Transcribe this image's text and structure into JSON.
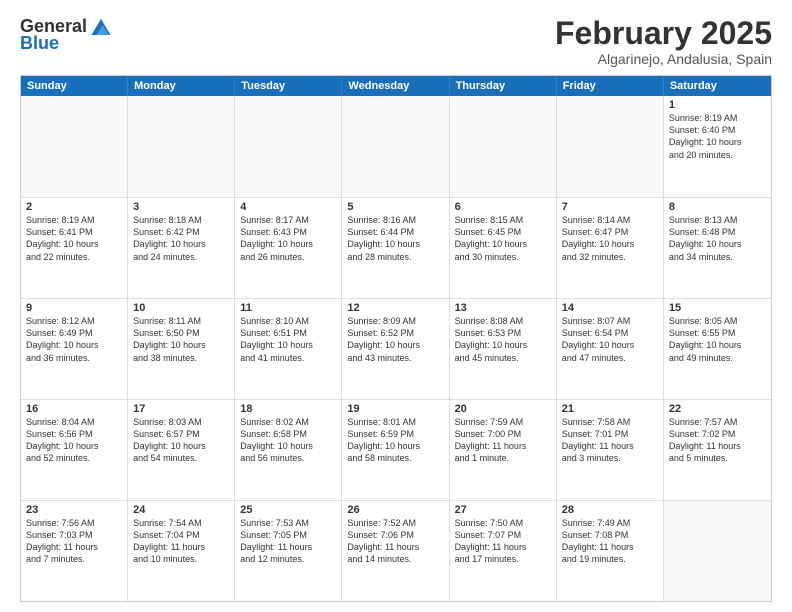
{
  "header": {
    "logo": {
      "general": "General",
      "blue": "Blue"
    },
    "title": "February 2025",
    "subtitle": "Algarinejo, Andalusia, Spain"
  },
  "days_of_week": [
    "Sunday",
    "Monday",
    "Tuesday",
    "Wednesday",
    "Thursday",
    "Friday",
    "Saturday"
  ],
  "weeks": [
    [
      {
        "day": "",
        "empty": true
      },
      {
        "day": "",
        "empty": true
      },
      {
        "day": "",
        "empty": true
      },
      {
        "day": "",
        "empty": true
      },
      {
        "day": "",
        "empty": true
      },
      {
        "day": "",
        "empty": true
      },
      {
        "day": "1",
        "lines": [
          "Sunrise: 8:19 AM",
          "Sunset: 6:40 PM",
          "Daylight: 10 hours",
          "and 20 minutes."
        ]
      }
    ],
    [
      {
        "day": "2",
        "lines": [
          "Sunrise: 8:19 AM",
          "Sunset: 6:41 PM",
          "Daylight: 10 hours",
          "and 22 minutes."
        ]
      },
      {
        "day": "3",
        "lines": [
          "Sunrise: 8:18 AM",
          "Sunset: 6:42 PM",
          "Daylight: 10 hours",
          "and 24 minutes."
        ]
      },
      {
        "day": "4",
        "lines": [
          "Sunrise: 8:17 AM",
          "Sunset: 6:43 PM",
          "Daylight: 10 hours",
          "and 26 minutes."
        ]
      },
      {
        "day": "5",
        "lines": [
          "Sunrise: 8:16 AM",
          "Sunset: 6:44 PM",
          "Daylight: 10 hours",
          "and 28 minutes."
        ]
      },
      {
        "day": "6",
        "lines": [
          "Sunrise: 8:15 AM",
          "Sunset: 6:45 PM",
          "Daylight: 10 hours",
          "and 30 minutes."
        ]
      },
      {
        "day": "7",
        "lines": [
          "Sunrise: 8:14 AM",
          "Sunset: 6:47 PM",
          "Daylight: 10 hours",
          "and 32 minutes."
        ]
      },
      {
        "day": "8",
        "lines": [
          "Sunrise: 8:13 AM",
          "Sunset: 6:48 PM",
          "Daylight: 10 hours",
          "and 34 minutes."
        ]
      }
    ],
    [
      {
        "day": "9",
        "lines": [
          "Sunrise: 8:12 AM",
          "Sunset: 6:49 PM",
          "Daylight: 10 hours",
          "and 36 minutes."
        ]
      },
      {
        "day": "10",
        "lines": [
          "Sunrise: 8:11 AM",
          "Sunset: 6:50 PM",
          "Daylight: 10 hours",
          "and 38 minutes."
        ]
      },
      {
        "day": "11",
        "lines": [
          "Sunrise: 8:10 AM",
          "Sunset: 6:51 PM",
          "Daylight: 10 hours",
          "and 41 minutes."
        ]
      },
      {
        "day": "12",
        "lines": [
          "Sunrise: 8:09 AM",
          "Sunset: 6:52 PM",
          "Daylight: 10 hours",
          "and 43 minutes."
        ]
      },
      {
        "day": "13",
        "lines": [
          "Sunrise: 8:08 AM",
          "Sunset: 6:53 PM",
          "Daylight: 10 hours",
          "and 45 minutes."
        ]
      },
      {
        "day": "14",
        "lines": [
          "Sunrise: 8:07 AM",
          "Sunset: 6:54 PM",
          "Daylight: 10 hours",
          "and 47 minutes."
        ]
      },
      {
        "day": "15",
        "lines": [
          "Sunrise: 8:05 AM",
          "Sunset: 6:55 PM",
          "Daylight: 10 hours",
          "and 49 minutes."
        ]
      }
    ],
    [
      {
        "day": "16",
        "lines": [
          "Sunrise: 8:04 AM",
          "Sunset: 6:56 PM",
          "Daylight: 10 hours",
          "and 52 minutes."
        ]
      },
      {
        "day": "17",
        "lines": [
          "Sunrise: 8:03 AM",
          "Sunset: 6:57 PM",
          "Daylight: 10 hours",
          "and 54 minutes."
        ]
      },
      {
        "day": "18",
        "lines": [
          "Sunrise: 8:02 AM",
          "Sunset: 6:58 PM",
          "Daylight: 10 hours",
          "and 56 minutes."
        ]
      },
      {
        "day": "19",
        "lines": [
          "Sunrise: 8:01 AM",
          "Sunset: 6:59 PM",
          "Daylight: 10 hours",
          "and 58 minutes."
        ]
      },
      {
        "day": "20",
        "lines": [
          "Sunrise: 7:59 AM",
          "Sunset: 7:00 PM",
          "Daylight: 11 hours",
          "and 1 minute."
        ]
      },
      {
        "day": "21",
        "lines": [
          "Sunrise: 7:58 AM",
          "Sunset: 7:01 PM",
          "Daylight: 11 hours",
          "and 3 minutes."
        ]
      },
      {
        "day": "22",
        "lines": [
          "Sunrise: 7:57 AM",
          "Sunset: 7:02 PM",
          "Daylight: 11 hours",
          "and 5 minutes."
        ]
      }
    ],
    [
      {
        "day": "23",
        "lines": [
          "Sunrise: 7:56 AM",
          "Sunset: 7:03 PM",
          "Daylight: 11 hours",
          "and 7 minutes."
        ]
      },
      {
        "day": "24",
        "lines": [
          "Sunrise: 7:54 AM",
          "Sunset: 7:04 PM",
          "Daylight: 11 hours",
          "and 10 minutes."
        ]
      },
      {
        "day": "25",
        "lines": [
          "Sunrise: 7:53 AM",
          "Sunset: 7:05 PM",
          "Daylight: 11 hours",
          "and 12 minutes."
        ]
      },
      {
        "day": "26",
        "lines": [
          "Sunrise: 7:52 AM",
          "Sunset: 7:06 PM",
          "Daylight: 11 hours",
          "and 14 minutes."
        ]
      },
      {
        "day": "27",
        "lines": [
          "Sunrise: 7:50 AM",
          "Sunset: 7:07 PM",
          "Daylight: 11 hours",
          "and 17 minutes."
        ]
      },
      {
        "day": "28",
        "lines": [
          "Sunrise: 7:49 AM",
          "Sunset: 7:08 PM",
          "Daylight: 11 hours",
          "and 19 minutes."
        ]
      },
      {
        "day": "",
        "empty": true
      }
    ]
  ]
}
